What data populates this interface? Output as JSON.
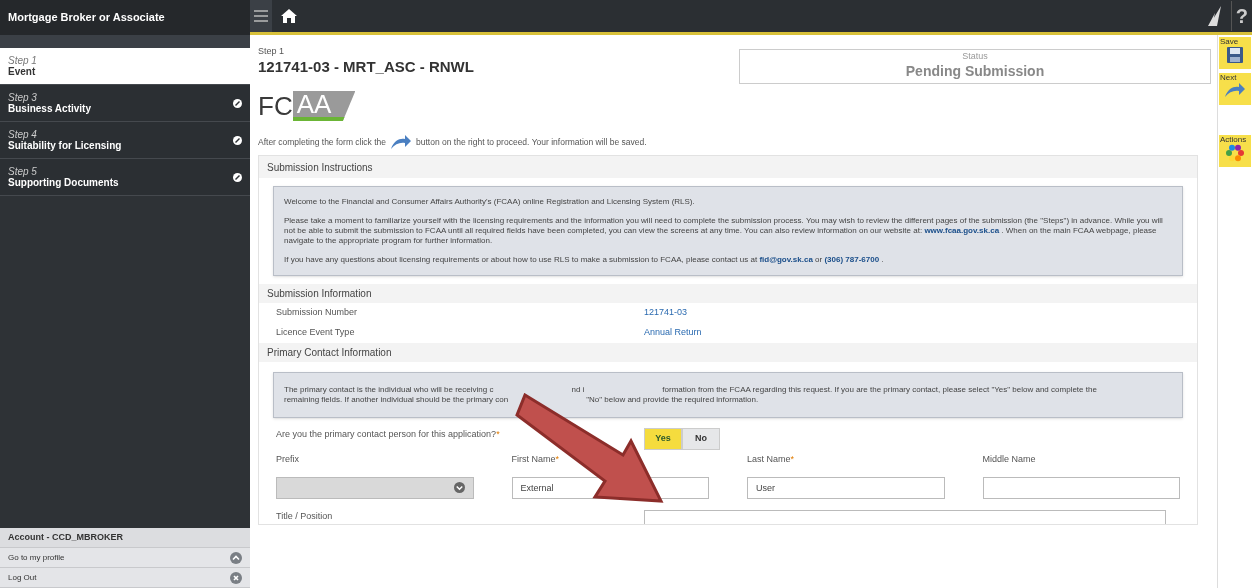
{
  "sidebar": {
    "title": "Mortgage Broker or Associate",
    "steps": [
      {
        "step": "Step 1",
        "name": "Event",
        "selected": true,
        "editable": false
      },
      {
        "step": "Step 3",
        "name": "Business Activity",
        "selected": false,
        "editable": true
      },
      {
        "step": "Step 4",
        "name": "Suitability for Licensing",
        "selected": false,
        "editable": true
      },
      {
        "step": "Step 5",
        "name": "Supporting Documents",
        "selected": false,
        "editable": true
      }
    ],
    "account": {
      "title": "Account - CCD_MBROKER",
      "links": [
        {
          "label": "Go to my profile",
          "kind": "expand"
        },
        {
          "label": "Log Out",
          "kind": "close"
        }
      ]
    }
  },
  "topbar": {
    "help": "?"
  },
  "header": {
    "step": "Step 1",
    "title": "121741-03 - MRT_ASC - RNWL",
    "status_label": "Status",
    "status": "Pending Submission",
    "logo": [
      "FC",
      "AA"
    ]
  },
  "hint": {
    "before": "After completing the form click the",
    "after": "button on the right to proceed. Your information will be saved."
  },
  "toolbar": [
    {
      "label": "Save",
      "kind": "save"
    },
    {
      "label": "Next",
      "kind": "next"
    },
    {
      "label": "Actions",
      "kind": "actions"
    }
  ],
  "instructions": {
    "title": "Submission Instructions",
    "paragraphs": [
      [
        {
          "text": "Welcome to the Financial and Consumer Affairs Authority's (FCAA) online Registration and Licensing System (RLS).",
          "link": false
        }
      ],
      [
        {
          "text": "Please take a moment to familiarize yourself with the licensing requirements and the information you will need to complete the submission process. You may wish to review the different pages of the submission (the \"Steps\") in advance. While you will not be able to submit the submission to FCAA until all required fields have been completed, you can view the screens at any time. You can also review information on our website at:",
          "link": false
        },
        {
          "text": "www.fcaa.gov.sk.ca",
          "link": true
        },
        {
          "text": ". When on the main FCAA webpage, please navigate to the appropriate program for further information.",
          "link": false
        }
      ],
      [
        {
          "text": "If you have any questions about licensing requirements or about how to use RLS to make a submission to FCAA, please contact us at",
          "link": false
        },
        {
          "text": "fid@gov.sk.ca",
          "link": true
        },
        {
          "text": "or",
          "link": false
        },
        {
          "text": "(306) 787-6700",
          "link": true
        },
        {
          "text": ".",
          "link": false
        }
      ]
    ]
  },
  "submission": {
    "title": "Submission Information",
    "rows": [
      {
        "label": "Submission Number",
        "value": "121741-03"
      },
      {
        "label": "Licence Event Type",
        "value": "Annual Return"
      }
    ]
  },
  "contact": {
    "title": "Primary Contact Information",
    "note_lines": [
      [
        "The primary contact is the individual who will be receiving c",
        "nd i",
        "formation from the FCAA regarding this request. If you are the primary contact, please select \"Yes\" below and complete the"
      ],
      [
        "remaining fields. If another individual should be the primary con",
        "\"No\" below and provide the required information."
      ]
    ],
    "question": "Are you the primary contact person for this application?",
    "question_required": true,
    "options": [
      {
        "label": "Yes",
        "selected": true
      },
      {
        "label": "No",
        "selected": false
      }
    ],
    "required_mark": "*",
    "fields": [
      {
        "label": "Prefix",
        "kind": "select",
        "required": false
      },
      {
        "label": "First Name",
        "kind": "text",
        "required": true,
        "value": "External"
      },
      {
        "label": "Last Name",
        "kind": "text",
        "required": true,
        "value": "User"
      },
      {
        "label": "Middle Name",
        "kind": "text",
        "required": false
      }
    ],
    "next_label": "Title / Position"
  }
}
